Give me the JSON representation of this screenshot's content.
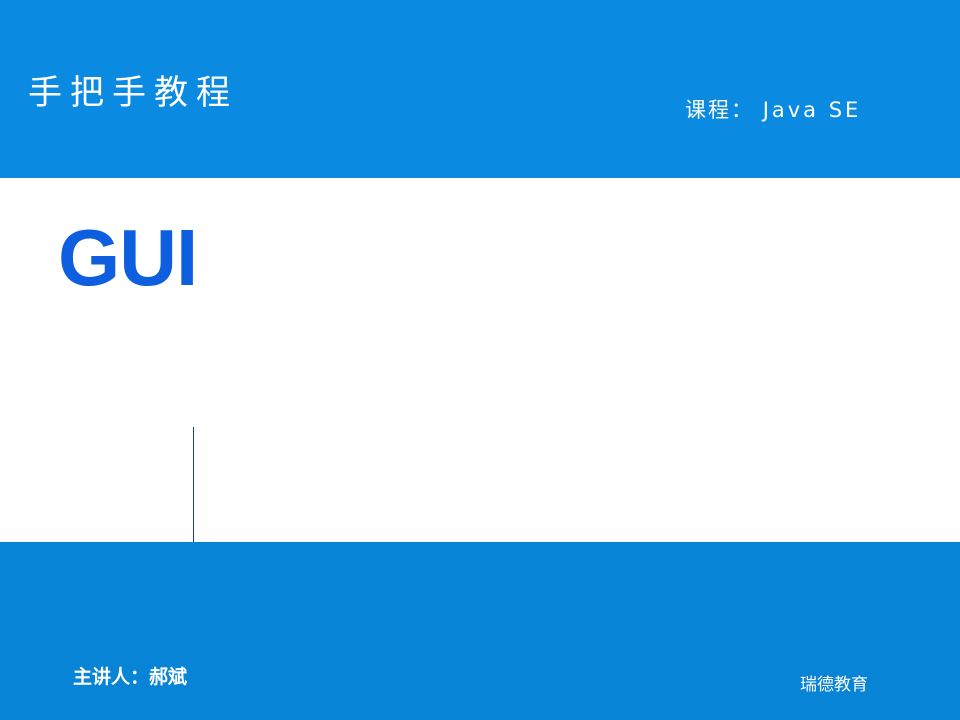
{
  "header": {
    "series_title": "手把手教程",
    "course_label": "课程：",
    "course_name": "Java SE"
  },
  "main": {
    "topic_title": "GUI"
  },
  "footer": {
    "presenter": "主讲人：郝斌",
    "organization": "瑞德教育"
  },
  "colors": {
    "band_top": "#0a8ae0",
    "band_bottom": "#0784d6",
    "title_blue": "#0d5fe0",
    "divider": "#1a3f8f"
  }
}
